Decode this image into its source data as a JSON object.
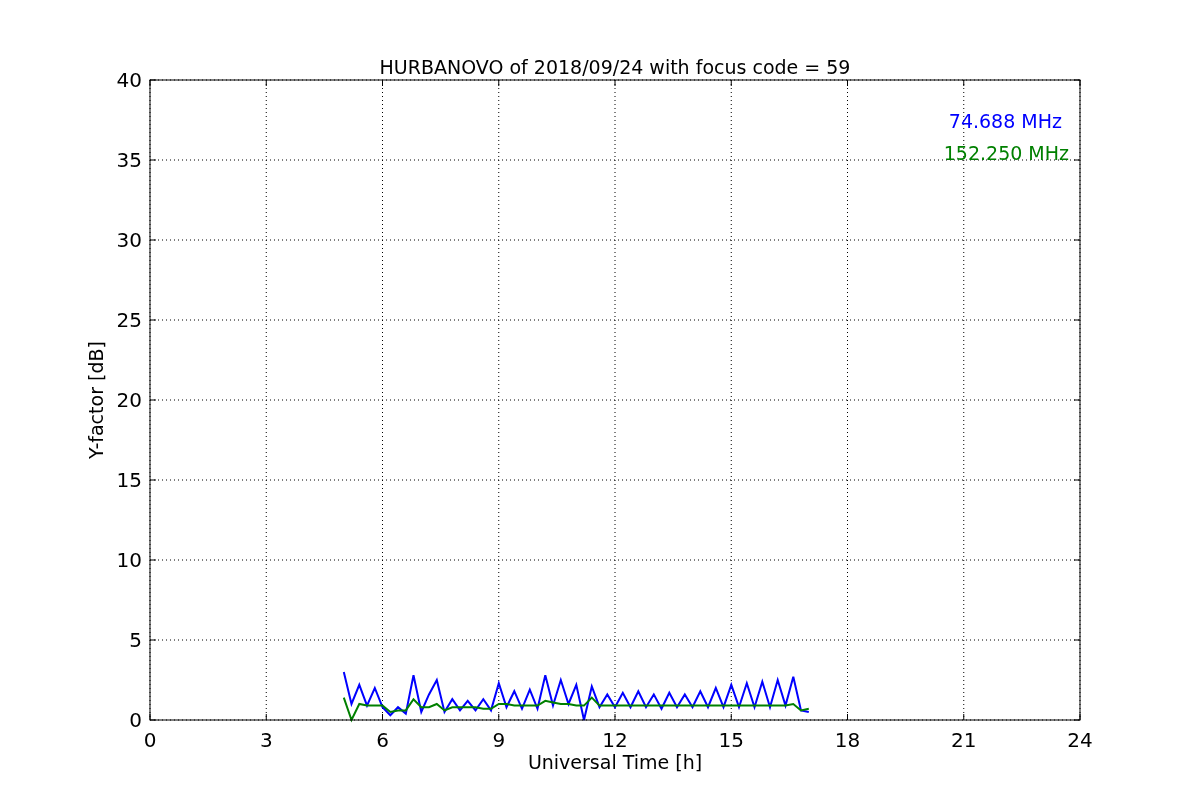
{
  "figure": {
    "chart_data": {
      "type": "line",
      "title": "HURBANOVO of 2018/09/24 with focus code = 59",
      "xlabel": "Universal Time [h]",
      "ylabel": "Y-factor [dB]",
      "x": [
        5.0,
        5.2,
        5.4,
        5.6,
        5.8,
        6.0,
        6.2,
        6.4,
        6.6,
        6.8,
        7.0,
        7.2,
        7.4,
        7.6,
        7.8,
        8.0,
        8.2,
        8.4,
        8.6,
        8.8,
        9.0,
        9.2,
        9.4,
        9.6,
        9.8,
        10.0,
        10.2,
        10.4,
        10.6,
        10.8,
        11.0,
        11.2,
        11.4,
        11.6,
        11.8,
        12.0,
        12.2,
        12.4,
        12.6,
        12.8,
        13.0,
        13.2,
        13.4,
        13.6,
        13.8,
        14.0,
        14.2,
        14.4,
        14.6,
        14.8,
        15.0,
        15.2,
        15.4,
        15.6,
        15.8,
        16.0,
        16.2,
        16.4,
        16.6,
        16.8,
        17.0
      ],
      "series": [
        {
          "name": "74.688 MHz",
          "color": "#0000ff",
          "values": [
            3.0,
            1.0,
            2.2,
            0.9,
            2.0,
            0.8,
            0.3,
            0.8,
            0.4,
            2.8,
            0.5,
            1.6,
            2.5,
            0.5,
            1.3,
            0.6,
            1.2,
            0.6,
            1.3,
            0.6,
            2.3,
            0.8,
            1.8,
            0.7,
            1.9,
            0.7,
            2.8,
            0.9,
            2.5,
            1.0,
            2.2,
            0.0,
            2.1,
            0.8,
            1.6,
            0.8,
            1.7,
            0.8,
            1.8,
            0.8,
            1.6,
            0.7,
            1.7,
            0.8,
            1.6,
            0.8,
            1.8,
            0.8,
            2.0,
            0.8,
            2.2,
            0.8,
            2.3,
            0.8,
            2.4,
            0.8,
            2.5,
            0.9,
            2.7,
            0.6,
            0.5
          ]
        },
        {
          "name": "152.250 MHz",
          "color": "#008000",
          "values": [
            1.4,
            0.0,
            1.0,
            0.9,
            0.9,
            0.9,
            0.5,
            0.6,
            0.6,
            1.3,
            0.8,
            0.8,
            1.0,
            0.6,
            0.8,
            0.8,
            0.8,
            0.8,
            0.7,
            0.7,
            1.0,
            1.0,
            0.9,
            0.9,
            0.9,
            0.9,
            1.2,
            1.1,
            1.0,
            1.0,
            0.9,
            0.9,
            1.4,
            0.9,
            0.9,
            0.9,
            0.9,
            0.9,
            0.9,
            0.9,
            0.9,
            0.9,
            0.9,
            0.9,
            0.9,
            0.9,
            0.9,
            0.9,
            0.9,
            0.9,
            0.9,
            0.9,
            0.9,
            0.9,
            0.9,
            0.9,
            0.9,
            0.9,
            1.0,
            0.6,
            0.7
          ]
        }
      ],
      "xlim": [
        0,
        24
      ],
      "ylim": [
        0,
        40
      ],
      "grid": true,
      "xticks": [
        0,
        3,
        6,
        9,
        12,
        15,
        18,
        21,
        24
      ],
      "yticks": [
        0,
        5,
        10,
        15,
        20,
        25,
        30,
        35,
        40
      ]
    }
  }
}
